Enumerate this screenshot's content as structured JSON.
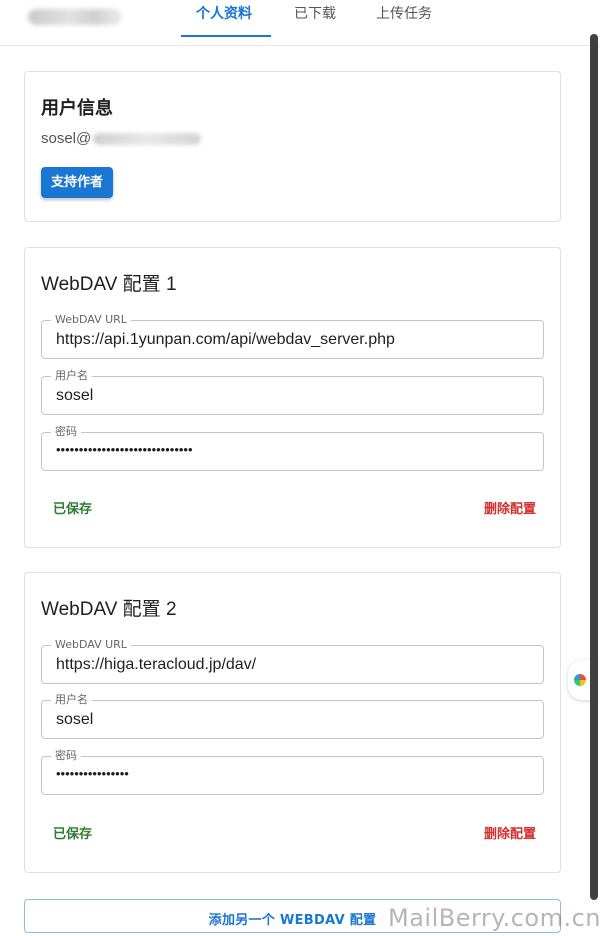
{
  "nav": {
    "tabs": [
      {
        "label": "个人资料",
        "active": true
      },
      {
        "label": "已下载",
        "active": false
      },
      {
        "label": "上传任务",
        "active": false
      }
    ]
  },
  "user_card": {
    "title": "用户信息",
    "email_prefix": "sosel@",
    "support_button": "支持作者"
  },
  "webdav_configs": [
    {
      "title": "WebDAV 配置 1",
      "url_label": "WebDAV URL",
      "url": "https://api.1yunpan.com/api/webdav_server.php",
      "username_label": "用户名",
      "username": "sosel",
      "password_label": "密码",
      "password_masked": "••••••••••••••••••••••••••••••",
      "status": "已保存",
      "delete_label": "删除配置"
    },
    {
      "title": "WebDAV 配置 2",
      "url_label": "WebDAV URL",
      "url": "https://higa.teracloud.jp/dav/",
      "username_label": "用户名",
      "username": "sosel",
      "password_label": "密码",
      "password_masked": "••••••••••••••••",
      "status": "已保存",
      "delete_label": "删除配置"
    }
  ],
  "add_button": "添加另一个 WEBDAV 配置",
  "watermark": "MailBerry.com.cn",
  "colors": {
    "accent": "#1976d2",
    "saved": "#2e7d32",
    "delete": "#d32f2f"
  }
}
